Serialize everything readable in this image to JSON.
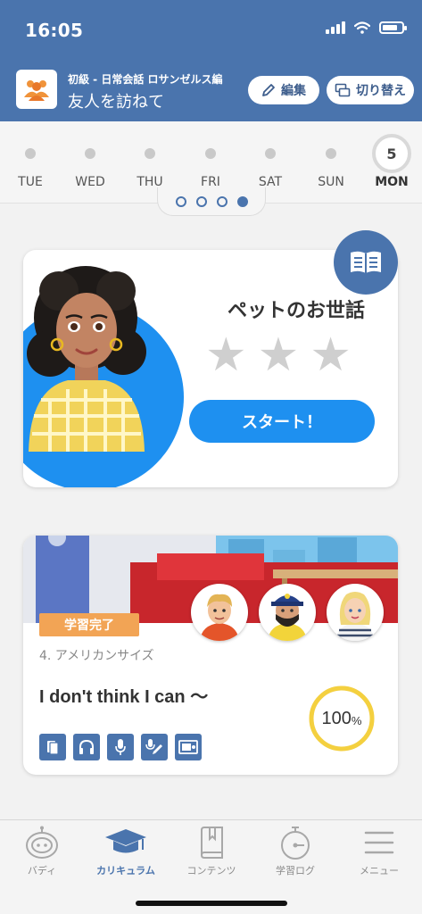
{
  "status_bar": {
    "time": "16:05"
  },
  "header": {
    "course_subtitle": "初級 - 日常会話 ロサンゼルス編",
    "course_title": "友人を訪ねて",
    "edit_label": "編集",
    "switch_label": "切り替え"
  },
  "week": {
    "days": [
      {
        "label": "TUE"
      },
      {
        "label": "WED"
      },
      {
        "label": "THU"
      },
      {
        "label": "FRI"
      },
      {
        "label": "SAT"
      },
      {
        "label": "SUN"
      },
      {
        "label": "MON",
        "date": "5",
        "today": true
      }
    ],
    "page_count": 4,
    "active_page": 4
  },
  "lesson_card": {
    "title": "ペットのお世話",
    "stars_earned": 0,
    "stars_total": 3,
    "start_label": "スタート！"
  },
  "episode_card": {
    "badge": "学習完了",
    "episode": "4. アメリカンサイズ",
    "title": "I don't think I can 〜",
    "progress_value": "100",
    "progress_unit": "%",
    "progress_fraction": 1.0,
    "skills": [
      "cards-icon",
      "headphones-icon",
      "microphone-icon",
      "speak-write-icon",
      "video-icon"
    ]
  },
  "tabs": [
    {
      "label": "バディ",
      "icon": "buddy-icon",
      "active": false
    },
    {
      "label": "カリキュラム",
      "icon": "mortarboard-icon",
      "active": true
    },
    {
      "label": "コンテンツ",
      "icon": "book-icon",
      "active": false
    },
    {
      "label": "学習ログ",
      "icon": "stopwatch-icon",
      "active": false
    },
    {
      "label": "メニュー",
      "icon": "menu-icon",
      "active": false
    }
  ],
  "colors": {
    "header": "#4a74ad",
    "accent_blue": "#1e90f0",
    "badge_orange": "#f2a455",
    "progress_gold": "#f4d03f"
  }
}
